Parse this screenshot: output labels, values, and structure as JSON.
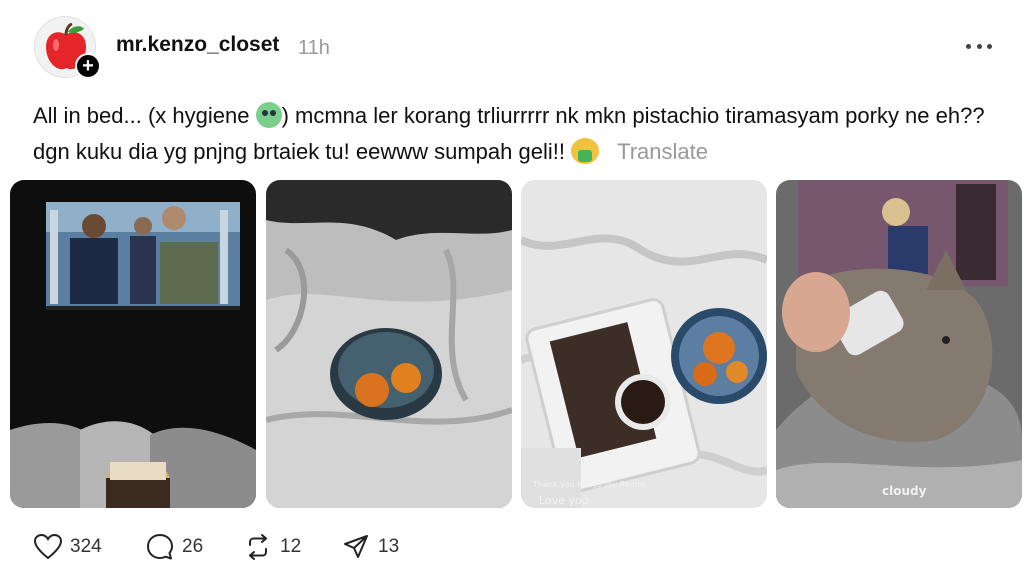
{
  "post": {
    "username": "mr.kenzo_closet",
    "time": "11h",
    "caption_part1": "All in bed... (x hygiene ",
    "caption_part2": ") mcmna ler korang trliurrrrr nk mkn pistachio tiramasyam porky ne eh?? dgn kuku dia yg pnjng brtaiek tu! eewww sumpah geli!! ",
    "translate_label": "Translate",
    "emojis": [
      "sick-face-emoji",
      "vomiting-face-emoji"
    ]
  },
  "media": {
    "photo3_text_bottom": "Thank you Boeys @u.flemm",
    "photo3_text_love": "Love you",
    "photo4_watermark": "cloudy"
  },
  "actions": {
    "likes": "324",
    "replies": "26",
    "reposts": "12",
    "shares": "13"
  }
}
